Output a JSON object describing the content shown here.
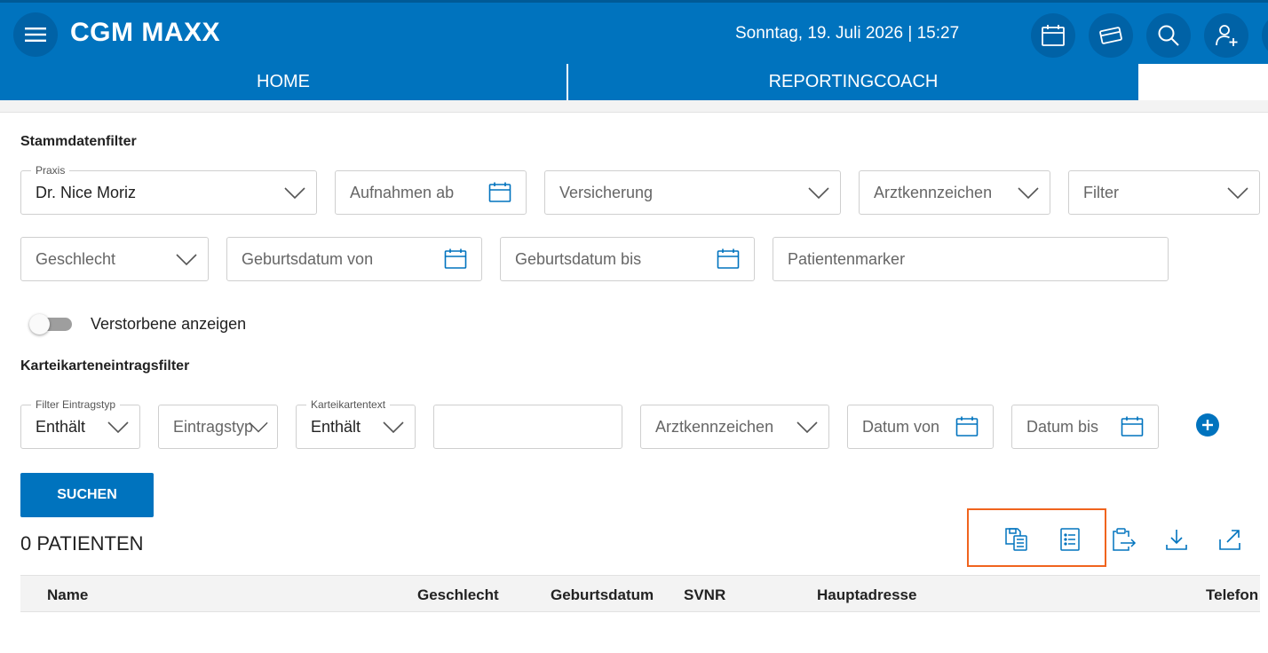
{
  "header": {
    "brand": "CGM MAXX",
    "datetime": "Sonntag, 19. Juli 2026 | 15:27",
    "icons": [
      "menu-icon",
      "calendar-icon",
      "card-icon",
      "search-icon",
      "add-person-icon"
    ]
  },
  "tabs": [
    {
      "label": "HOME"
    },
    {
      "label": "REPORTINGCOACH"
    }
  ],
  "stammdaten": {
    "title": "Stammdatenfilter",
    "praxis": {
      "label": "Praxis",
      "value": "Dr. Nice Moriz"
    },
    "aufnahmen_ab": {
      "placeholder": "Aufnahmen ab"
    },
    "versicherung": {
      "placeholder": "Versicherung"
    },
    "arztkennzeichen": {
      "placeholder": "Arztkennzeichen"
    },
    "filter": {
      "placeholder": "Filter"
    },
    "geschlecht": {
      "placeholder": "Geschlecht"
    },
    "geburtsdatum_von": {
      "placeholder": "Geburtsdatum von"
    },
    "geburtsdatum_bis": {
      "placeholder": "Geburtsdatum bis"
    },
    "patientenmarker": {
      "placeholder": "Patientenmarker"
    }
  },
  "toggle": {
    "label": "Verstorbene anzeigen",
    "checked": false
  },
  "kartei": {
    "title": "Karteikarteneintragsfilter",
    "filter_eintragstyp": {
      "label": "Filter Eintragstyp",
      "value": "Enthält"
    },
    "eintragstyp": {
      "placeholder": "Eintragstyp"
    },
    "karteikartentext": {
      "label": "Karteikartentext",
      "value": "Enthält"
    },
    "text_value": "",
    "arztkennzeichen": {
      "placeholder": "Arztkennzeichen"
    },
    "datum_von": {
      "placeholder": "Datum von"
    },
    "datum_bis": {
      "placeholder": "Datum bis"
    }
  },
  "search_button": "SUCHEN",
  "result_count": "0 PATIENTEN",
  "table": {
    "columns": [
      "Name",
      "Geschlecht",
      "Geburtsdatum",
      "SVNR",
      "Hauptadresse",
      "Telefon"
    ]
  },
  "colors": {
    "primary": "#0073be",
    "highlight": "#f0641e"
  }
}
